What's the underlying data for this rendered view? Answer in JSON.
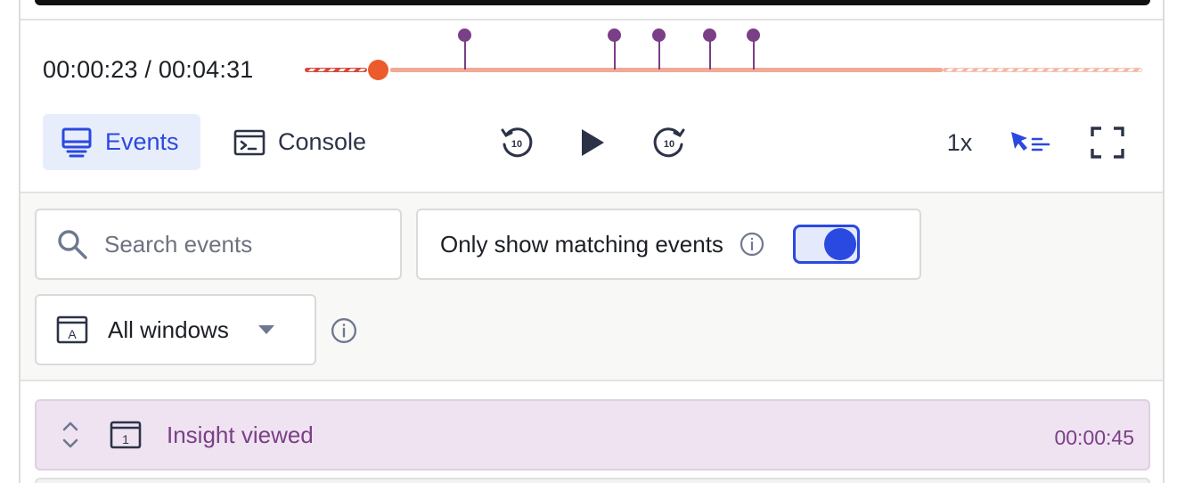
{
  "player": {
    "time_current": "00:00:23",
    "time_separator": " / ",
    "time_total": "00:04:31",
    "speed": "1x"
  },
  "tabs": {
    "events_label": "Events",
    "console_label": "Console",
    "active": "events"
  },
  "filters": {
    "search_placeholder": "Search events",
    "search_value": "",
    "match_label": "Only show matching events",
    "match_enabled": true,
    "window_selected": "All windows",
    "window_icon_letter": "A"
  },
  "events": [
    {
      "window_number": "1",
      "name": "Insight viewed",
      "time": "00:00:45"
    }
  ],
  "icons": {
    "events_tab": "monitor-icon",
    "console_tab": "terminal-icon",
    "back": "rewind-10-icon",
    "play": "play-icon",
    "forward": "forward-10-icon",
    "skip_inactive": "cursor-skip-icon",
    "fullscreen": "fullscreen-icon",
    "search": "search-icon",
    "info": "info-icon",
    "window": "window-icon",
    "caret": "caret-down-icon",
    "expand": "expand-icon"
  },
  "colors": {
    "accent": "#2a49e0",
    "playhead": "#ec5b2b",
    "event_marker": "#7a3f86",
    "event_row_bg": "#efe3f2"
  }
}
